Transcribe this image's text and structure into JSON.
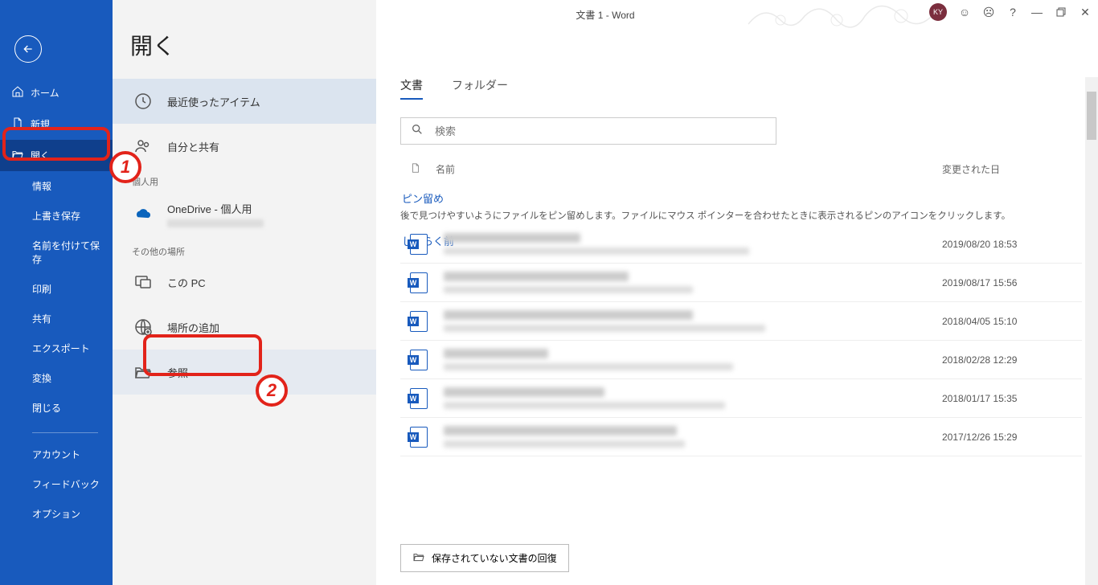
{
  "window": {
    "title": "文書 1  -  Word",
    "avatar": "KY"
  },
  "sidebar": {
    "items": [
      {
        "label": "ホーム",
        "icon": "home"
      },
      {
        "label": "新規",
        "icon": "file"
      },
      {
        "label": "開く",
        "icon": "folder-open",
        "active": true
      },
      {
        "label": "情報",
        "indent": true
      },
      {
        "label": "上書き保存",
        "indent": true
      },
      {
        "label": "名前を付けて保存",
        "indent": true
      },
      {
        "label": "印刷",
        "indent": true
      },
      {
        "label": "共有",
        "indent": true
      },
      {
        "label": "エクスポート",
        "indent": true
      },
      {
        "label": "変換",
        "indent": true
      },
      {
        "label": "閉じる",
        "indent": true
      }
    ],
    "footer": [
      "アカウント",
      "フィードバック",
      "オプション"
    ]
  },
  "locations": {
    "heading": "開く",
    "recent": "最近使ったアイテム",
    "shared": "自分と共有",
    "section_personal": "個人用",
    "onedrive": "OneDrive - 個人用",
    "section_other": "その他の場所",
    "thispc": "この PC",
    "addplace": "場所の追加",
    "browse": "参照"
  },
  "main": {
    "tabs": {
      "docs": "文書",
      "folders": "フォルダー"
    },
    "search_placeholder": "検索",
    "col_name": "名前",
    "col_date": "変更された日",
    "pinned_title": "ピン留め",
    "pinned_help": "後で見つけやすいようにファイルをピン留めします。ファイルにマウス ポインターを合わせたときに表示されるピンのアイコンをクリックします。",
    "recent_title": "しばらく前",
    "files": [
      {
        "date": "2019/08/20 18:53",
        "nw": 170,
        "pw": 380
      },
      {
        "date": "2019/08/17 15:56",
        "nw": 230,
        "pw": 310
      },
      {
        "date": "2018/04/05 15:10",
        "nw": 310,
        "pw": 400
      },
      {
        "date": "2018/02/28 12:29",
        "nw": 130,
        "pw": 360
      },
      {
        "date": "2018/01/17 15:35",
        "nw": 200,
        "pw": 350
      },
      {
        "date": "2017/12/26 15:29",
        "nw": 290,
        "pw": 300
      }
    ],
    "recover": "保存されていない文書の回復"
  },
  "annotations": {
    "one": "1",
    "two": "2"
  }
}
